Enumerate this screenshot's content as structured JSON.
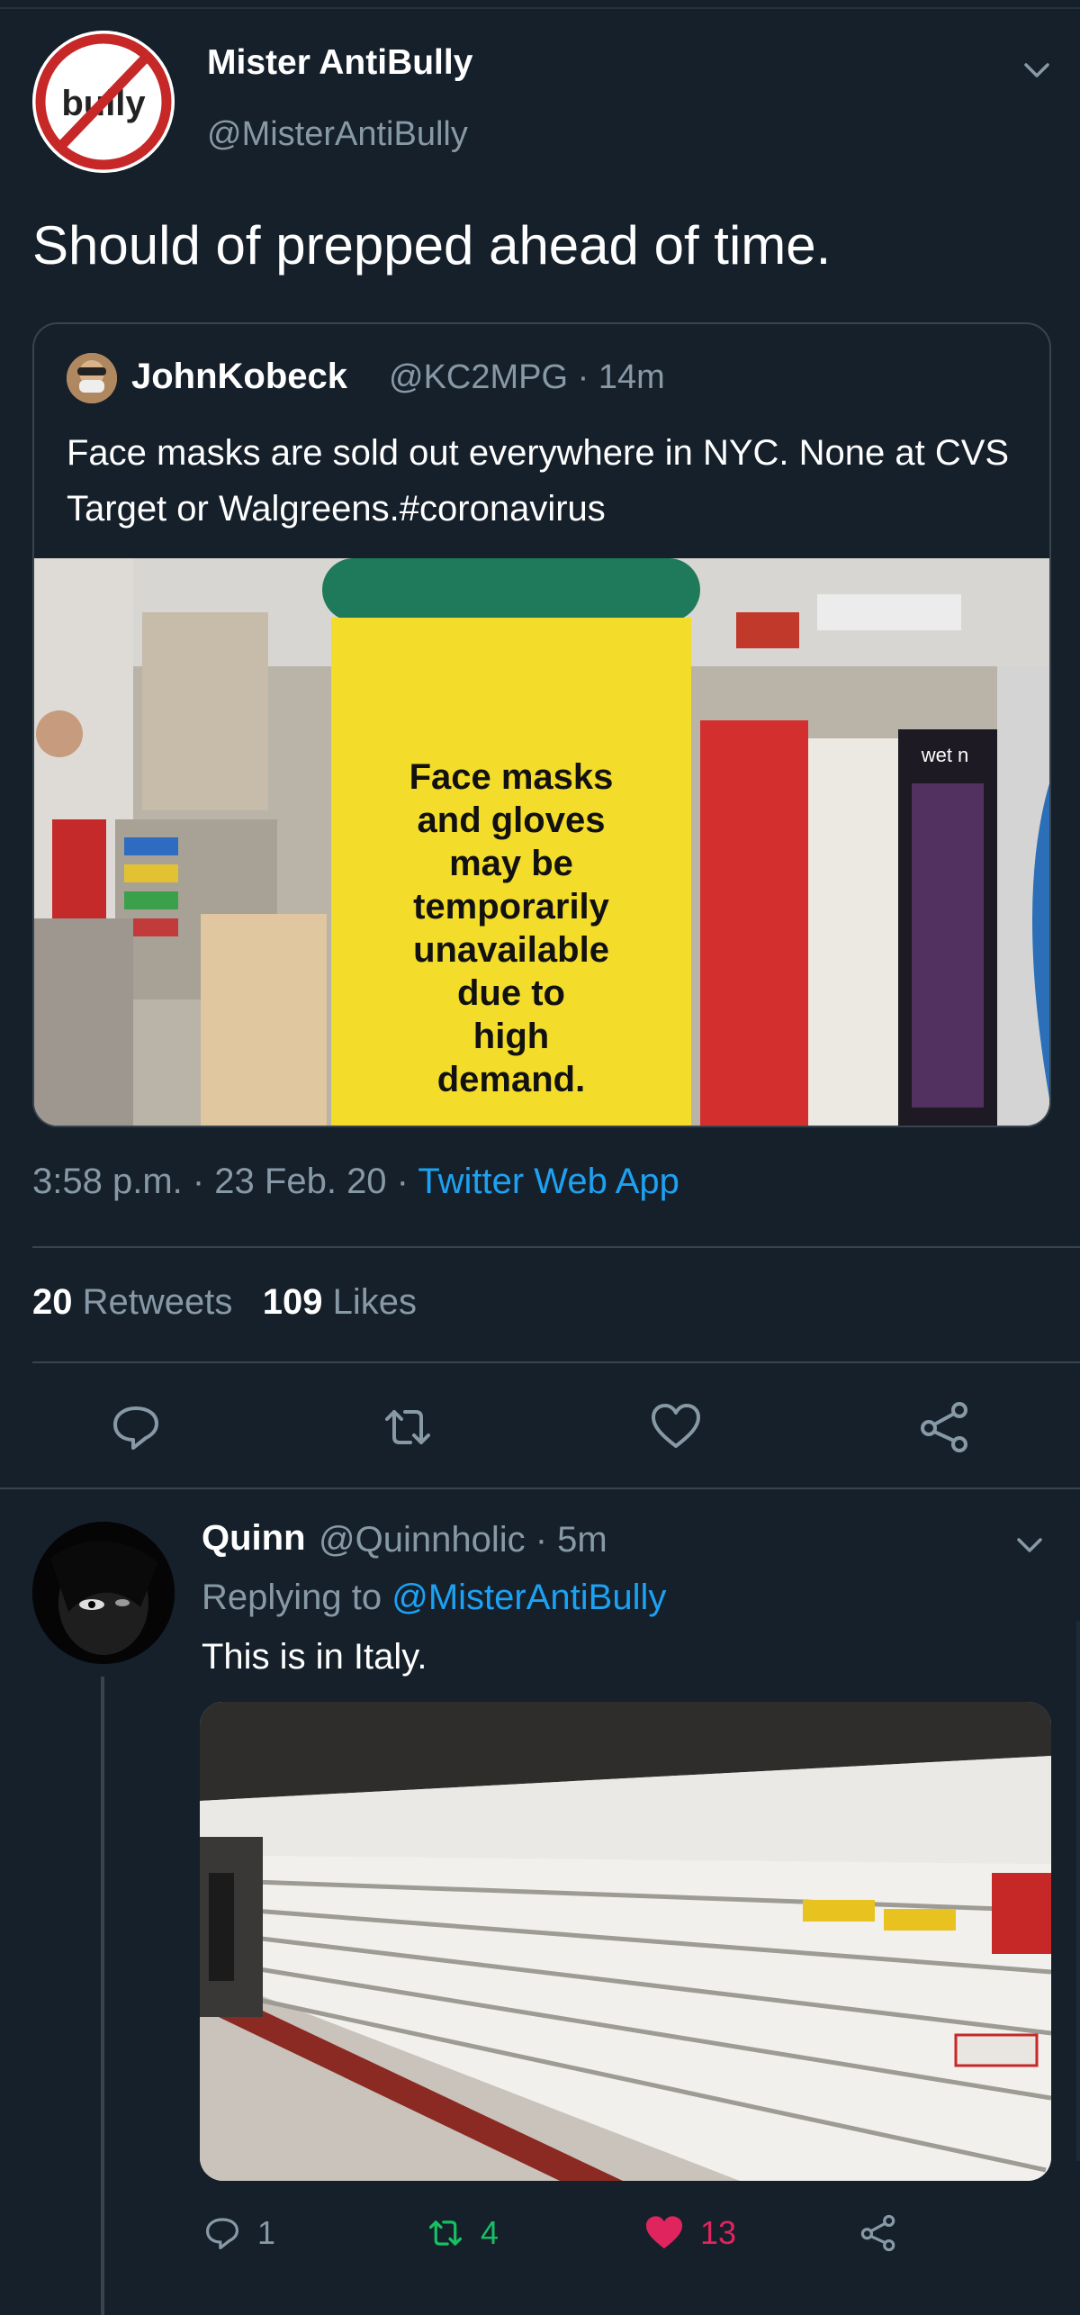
{
  "main_tweet": {
    "author_name": "Mister AntiBully",
    "author_handle": "@MisterAntiBully",
    "avatar_logo_text": "bully",
    "text": "Should of prepped ahead of time.",
    "timestamp": "3:58 p.m. · 23 Feb. 20 · ",
    "source_app": "Twitter Web App",
    "retweets_count": "20",
    "retweets_label": "Retweets",
    "likes_count": "109",
    "likes_label": "Likes",
    "icons": [
      "reply-icon",
      "retweet-icon",
      "like-icon",
      "share-icon",
      "chevron-down-icon"
    ]
  },
  "quoted_tweet": {
    "author_name": "JohnKobeck",
    "author_handle_time": "@KC2MPG · 14m",
    "text": "Face masks are sold out everywhere in NYC. None at CVS Target or Walgreens.#coronavirus",
    "photo_sign_lines": [
      "Face masks",
      "and gloves",
      "may be",
      "temporarily",
      "unavailable",
      "due to",
      "high",
      "demand."
    ],
    "photo_shelf_label": "wet n"
  },
  "reply": {
    "author_name": "Quinn",
    "author_handle_time": "@Quinnholic · 5m",
    "replying_prefix": "Replying to ",
    "replying_mention": "@MisterAntiBully",
    "text": "This is in Italy.",
    "reply_count": "1",
    "retweet_count": "4",
    "like_count": "13",
    "liked": true
  },
  "colors": {
    "background": "#15202b",
    "divider": "#38444d",
    "secondary_text": "#8899a6",
    "link": "#1da1f2",
    "retweet_green": "#17bf63",
    "like_pink": "#e0245e"
  }
}
